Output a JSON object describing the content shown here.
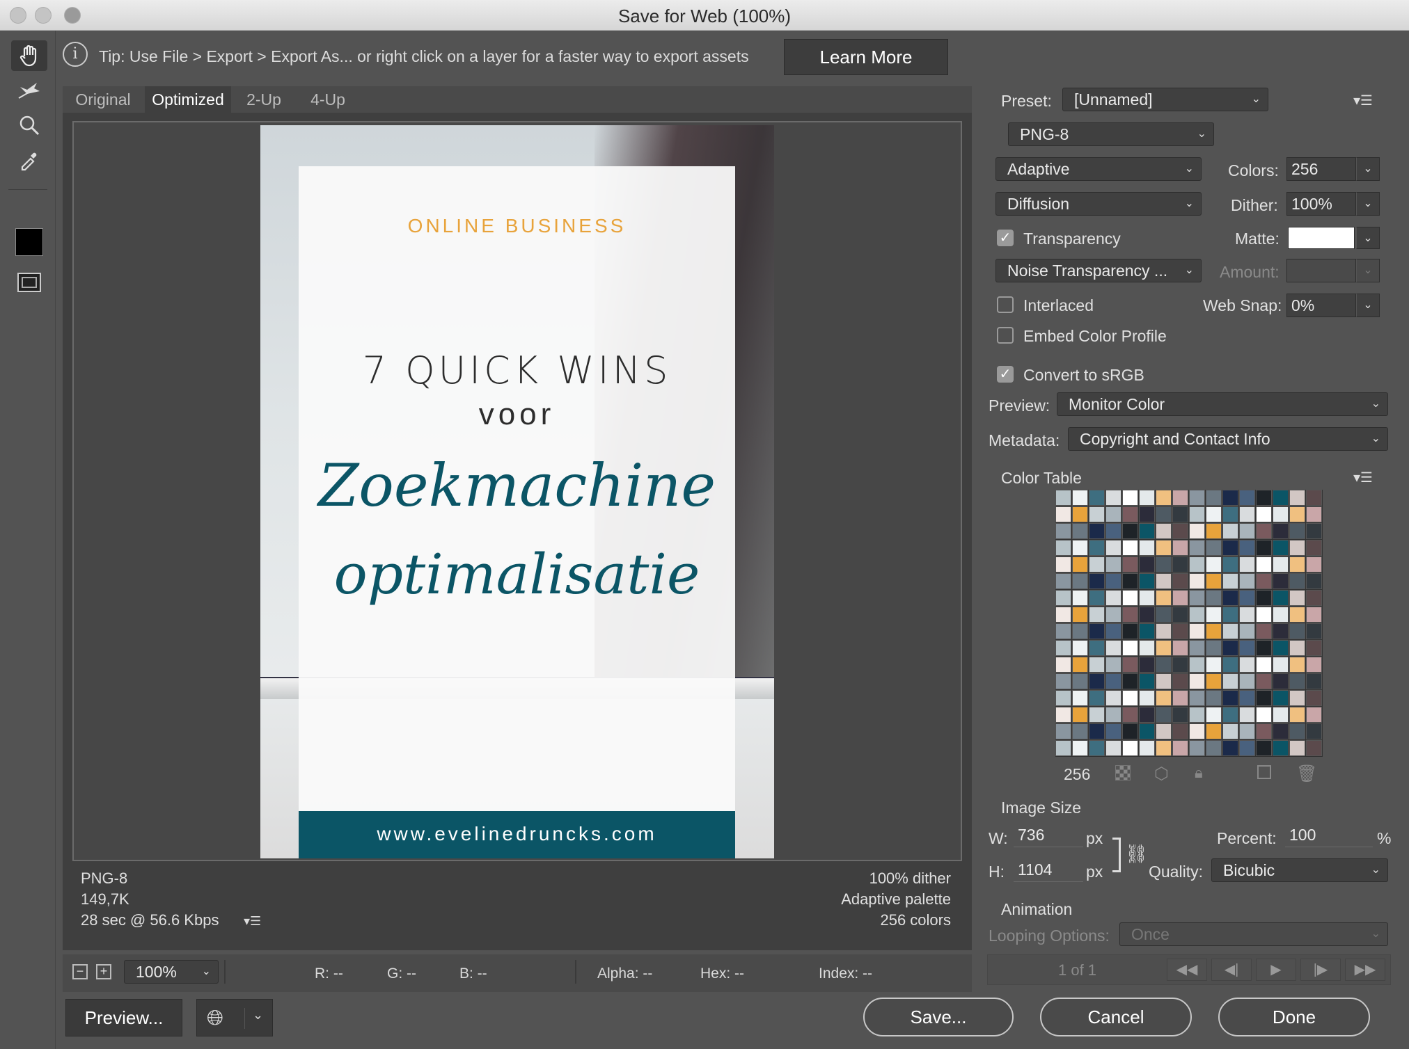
{
  "window": {
    "title": "Save for Web (100%)"
  },
  "tip": {
    "text": "Tip: Use File > Export > Export As...  or right click on a layer for a faster way to export assets",
    "learn_more": "Learn More"
  },
  "tabs": [
    "Original",
    "Optimized",
    "2-Up",
    "4-Up"
  ],
  "preview_image": {
    "category": "ONLINE BUSINESS",
    "headline": "7 QUICK WINS",
    "subline": "voor",
    "script1": "Zoekmachine",
    "script2": "optimalisatie",
    "url": "www.evelinedruncks.com"
  },
  "preview_info": {
    "format": "PNG-8",
    "size": "149,7K",
    "speed": "28 sec @ 56.6 Kbps",
    "dither": "100% dither",
    "palette": "Adaptive palette",
    "colors": "256 colors"
  },
  "settings": {
    "preset_label": "Preset:",
    "preset_value": "[Unnamed]",
    "format": "PNG-8",
    "reduction": "Adaptive",
    "colors_label": "Colors:",
    "colors_value": "256",
    "dither_algo": "Diffusion",
    "dither_label": "Dither:",
    "dither_value": "100%",
    "transparency": "Transparency",
    "matte_label": "Matte:",
    "transparency_dither": "Noise Transparency ...",
    "amount_label": "Amount:",
    "interlaced": "Interlaced",
    "websnap_label": "Web Snap:",
    "websnap_value": "0%",
    "embed": "Embed Color Profile",
    "srgb": "Convert to sRGB",
    "preview_label": "Preview:",
    "preview_value": "Monitor Color",
    "metadata_label": "Metadata:",
    "metadata_value": "Copyright and Contact Info"
  },
  "color_table": {
    "label": "Color Table",
    "count": "256"
  },
  "image_size": {
    "label": "Image Size",
    "w_label": "W:",
    "w_value": "736",
    "h_label": "H:",
    "h_value": "1104",
    "px": "px",
    "percent_label": "Percent:",
    "percent_value": "100",
    "pct": "%",
    "quality_label": "Quality:",
    "quality_value": "Bicubic"
  },
  "animation": {
    "label": "Animation",
    "looping_label": "Looping Options:",
    "looping_value": "Once",
    "frame": "1 of 1"
  },
  "status_bar": {
    "zoom": "100%",
    "r": "R: --",
    "g": "G: --",
    "b": "B: --",
    "alpha": "Alpha: --",
    "hex": "Hex: --",
    "index": "Index: --"
  },
  "buttons": {
    "preview": "Preview...",
    "save": "Save...",
    "cancel": "Cancel",
    "done": "Done"
  },
  "colors": {
    "accent_orange": "#e8a33b",
    "teal": "#0b5566"
  }
}
